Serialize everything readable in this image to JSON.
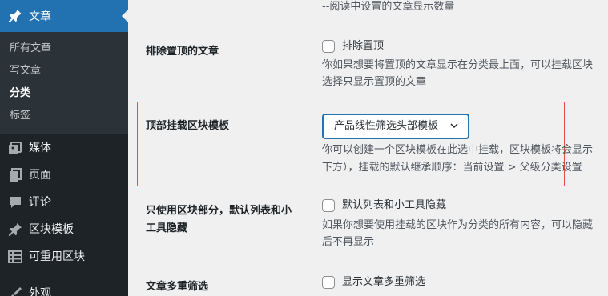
{
  "sidebar": {
    "active": {
      "label": "文章",
      "icon": "pin-icon"
    },
    "submenu": [
      {
        "label": "所有文章",
        "current": false
      },
      {
        "label": "写文章",
        "current": false
      },
      {
        "label": "分类",
        "current": true
      },
      {
        "label": "标签",
        "current": false
      }
    ],
    "items": [
      {
        "label": "媒体",
        "icon": "media-icon"
      },
      {
        "label": "页面",
        "icon": "page-icon"
      },
      {
        "label": "评论",
        "icon": "comment-icon"
      },
      {
        "label": "区块模板",
        "icon": "pin-icon"
      },
      {
        "label": "可重用区块",
        "icon": "table-icon"
      },
      {
        "label": "外观",
        "icon": "brush-icon"
      }
    ]
  },
  "settings": {
    "top_note": "--阅读中设置的文章显示数量",
    "exclude_sticky": {
      "title": "排除置顶的文章",
      "checkbox_label": "排除置顶",
      "desc": [
        "你如果想要将置顶的文章显示在分类最上面，可以挂载区块",
        "选择只显示置顶的文章"
      ]
    },
    "top_block": {
      "title": "顶部挂载区块模板",
      "select_value": "产品线性筛选头部模板",
      "desc": [
        "你可以创建一个区块模板在此选中挂载，区块模板将会显示",
        "下方），挂载的默认继承顺序：当前设置 > 父级分类设置"
      ]
    },
    "block_only": {
      "title": [
        "只使用区块部分，默认列表和小",
        "工具隐藏"
      ],
      "checkbox_label": "默认列表和小工具隐藏",
      "desc": [
        "如果你想要使用挂载的区块作为分类的所有内容，可以隐藏",
        "后不再显示"
      ]
    },
    "multi_filter": {
      "title": "文章多重筛选",
      "checkbox_label": "显示文章多重筛选"
    }
  },
  "colors": {
    "sidebar_bg": "#1d2327",
    "accent": "#2271b1",
    "highlight": "#e0504b"
  }
}
